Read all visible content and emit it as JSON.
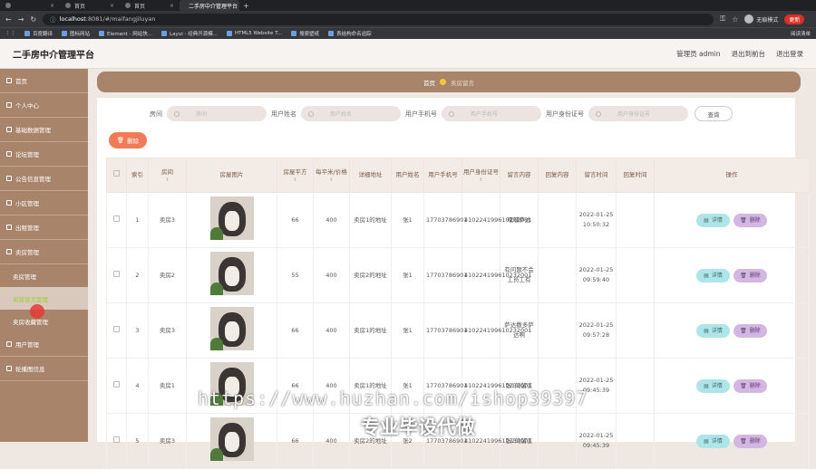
{
  "browser": {
    "tabs": [
      {
        "label": ""
      },
      {
        "label": "首页"
      },
      {
        "label": "首页"
      },
      {
        "label": "二手房中介管理平台"
      }
    ],
    "url_host": "localhost",
    "url_rest": ":8081/#/maifangjiluyan",
    "incognito_label": "无痕模式",
    "update_label": "更新",
    "bookmarks": [
      "百度翻译",
      "图标网站",
      "Element - 网站快...",
      "Layui - 经典开源模...",
      "HTML5 Website T...",
      "搜索壁纸",
      "表结构命名追踪"
    ],
    "bookmarks_right": "阅读清单"
  },
  "header": {
    "title": "二手房中介管理平台",
    "user": "管理员 admin",
    "to_front": "退出到前台",
    "logout": "退出登录"
  },
  "sidebar": {
    "items": [
      {
        "label": "首页"
      },
      {
        "label": "个人中心"
      },
      {
        "label": "基础数据管理"
      },
      {
        "label": "论坛管理"
      },
      {
        "label": "公告信息管理"
      },
      {
        "label": "小区管理"
      },
      {
        "label": "出租管理"
      },
      {
        "label": "卖房管理"
      }
    ],
    "subitems": [
      {
        "label": "卖房管理"
      },
      {
        "label": "卖房留言管理"
      },
      {
        "label": "卖房收藏管理"
      }
    ],
    "items_after": [
      {
        "label": "用户管理"
      },
      {
        "label": "轮播图信息"
      }
    ]
  },
  "breadcrumb": {
    "home": "首页",
    "current": "卖房留言"
  },
  "search": {
    "fields": [
      {
        "label": "房间",
        "placeholder": "房间"
      },
      {
        "label": "用户姓名",
        "placeholder": "用户姓名"
      },
      {
        "label": "用户手机号",
        "placeholder": "用户手机号"
      },
      {
        "label": "用户身份证号",
        "placeholder": "用户身份证号"
      }
    ],
    "button": "查询"
  },
  "delete_button": "删除",
  "table": {
    "columns": [
      "",
      "索引",
      "房间",
      "房屋图片",
      "房屋平方",
      "每平米/价格",
      "详细地址",
      "用户姓名",
      "用户手机号",
      "用户身份证号",
      "留言内容",
      "回复内容",
      "留言时间",
      "回复时间",
      "操作"
    ],
    "sortable": [
      false,
      false,
      true,
      false,
      true,
      true,
      false,
      false,
      false,
      true,
      false,
      false,
      false,
      false,
      false
    ],
    "rows": [
      {
        "index": "1",
        "room": "卖房3",
        "area": "66",
        "price": "400",
        "address": "卖房1的地址",
        "name": "张1",
        "phone": "17703786901",
        "idcard": "410224199610232001",
        "message": "嘿嘿萨达",
        "reply": "",
        "time": "2022-01-25 10:50:32",
        "reply_time": ""
      },
      {
        "index": "2",
        "room": "卖房2",
        "area": "55",
        "price": "400",
        "address": "卖房2的地址",
        "name": "张1",
        "phone": "17703786901",
        "idcard": "410224199610232001",
        "message": "有问题不会工员工有",
        "reply": "",
        "time": "2022-01-25 09:59:40",
        "reply_time": ""
      },
      {
        "index": "3",
        "room": "卖房3",
        "area": "66",
        "price": "400",
        "address": "卖房1的地址",
        "name": "张1",
        "phone": "17703786901",
        "idcard": "410224199610232001",
        "message": "萨达撒多萨达啊",
        "reply": "",
        "time": "2022-01-25 09:57:28",
        "reply_time": ""
      },
      {
        "index": "4",
        "room": "卖房1",
        "area": "66",
        "price": "400",
        "address": "卖房1的地址",
        "name": "张1",
        "phone": "17703786901",
        "idcard": "410224199610232001",
        "message": "张1的留言",
        "reply": "",
        "time": "2022-01-25 09:45:39",
        "reply_time": ""
      },
      {
        "index": "5",
        "room": "卖房3",
        "area": "66",
        "price": "400",
        "address": "卖房2的地址",
        "name": "张2",
        "phone": "17703786901",
        "idcard": "410224199610232001",
        "message": "张2的留言",
        "reply": "",
        "time": "2022-01-25 09:45:39",
        "reply_time": ""
      }
    ],
    "detail_label": "详情",
    "delete_label": "删除"
  },
  "watermark": {
    "url": "https://www.huzhan.com/ishop39397",
    "slogan": "专业毕设代做"
  }
}
